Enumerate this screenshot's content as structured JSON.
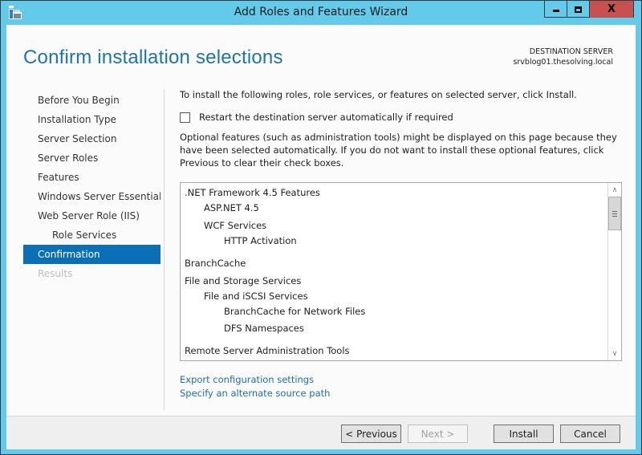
{
  "window": {
    "title": "Add Roles and Features Wizard",
    "controls": {
      "minimize": "minimize",
      "maximize": "maximize",
      "close": "X"
    },
    "accent_color": "#63caea",
    "close_color": "#c75050"
  },
  "header": {
    "page_title": "Confirm installation selections",
    "destination_label": "DESTINATION SERVER",
    "destination_value": "srvblog01.thesolving.local"
  },
  "sidebar": {
    "items": [
      {
        "label": "Before You Begin",
        "state": "normal"
      },
      {
        "label": "Installation Type",
        "state": "normal"
      },
      {
        "label": "Server Selection",
        "state": "normal"
      },
      {
        "label": "Server Roles",
        "state": "normal"
      },
      {
        "label": "Features",
        "state": "normal"
      },
      {
        "label": "Windows Server Essential...",
        "state": "normal"
      },
      {
        "label": "Web Server Role (IIS)",
        "state": "normal"
      },
      {
        "label": "Role Services",
        "state": "sub"
      },
      {
        "label": "Confirmation",
        "state": "active"
      },
      {
        "label": "Results",
        "state": "disabled"
      }
    ]
  },
  "main": {
    "intro": "To install the following roles, role services, or features on selected server, click Install.",
    "restart_checkbox": {
      "label": "Restart the destination server automatically if required",
      "checked": false
    },
    "note": "Optional features (such as administration tools) might be displayed on this page because they have been selected automatically. If you do not want to install these optional features, click Previous to clear their check boxes.",
    "selections": [
      {
        "label": ".NET Framework 4.5 Features",
        "level": 0
      },
      {
        "label": "ASP.NET 4.5",
        "level": 1
      },
      {
        "label": "WCF Services",
        "level": 1
      },
      {
        "label": "HTTP Activation",
        "level": 2
      },
      {
        "label": "BranchCache",
        "level": 0
      },
      {
        "label": "File and Storage Services",
        "level": 0
      },
      {
        "label": "File and iSCSI Services",
        "level": 1
      },
      {
        "label": "BranchCache for Network Files",
        "level": 2
      },
      {
        "label": "DFS Namespaces",
        "level": 2
      },
      {
        "label": "Remote Server Administration Tools",
        "level": 0
      }
    ],
    "links": {
      "export": "Export configuration settings",
      "alternate_source": "Specify an alternate source path"
    }
  },
  "footer": {
    "previous": "< Previous",
    "next": "Next >",
    "install": "Install",
    "cancel": "Cancel"
  }
}
